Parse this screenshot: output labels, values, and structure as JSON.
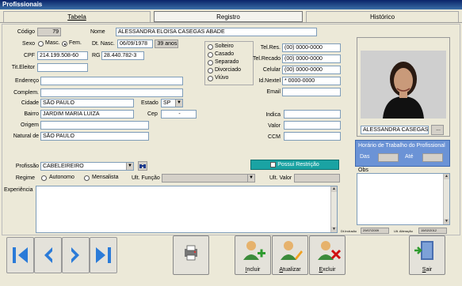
{
  "window": {
    "title": "Profissionais"
  },
  "tabs": [
    {
      "label": "Tabela"
    },
    {
      "label": "Registro"
    },
    {
      "label": "Histórico"
    }
  ],
  "form": {
    "codigo_label": "Código",
    "codigo_value": "79",
    "nome_label": "Nome",
    "nome_value": "ALESSANDRA ELOISA CASEGAS ABADE",
    "sexo_label": "Sexo",
    "sexo_masc": "Masc.",
    "sexo_fem": "Fem.",
    "dt_nasc_label": "Dt. Nasc.",
    "dt_nasc_value": "06/09/1978",
    "idade_value": "39 anos",
    "cpf_label": "CPF",
    "cpf_value": "214.199.508-60",
    "rg_label": "RG",
    "rg_value": "28.440.782-3",
    "tit_eleitor_label": "Tit.Eleitor",
    "tit_eleitor_value": "",
    "endereco_label": "Endereço",
    "endereco_value": "",
    "complem_label": "Complem.",
    "complem_value": "",
    "cidade_label": "Cidade",
    "cidade_value": "SÃO PAULO",
    "estado_label": "Estado",
    "estado_value": "SP",
    "bairro_label": "Bairro",
    "bairro_value": "JARDIM MARIA LUIZA",
    "cep_label": "Cep",
    "cep_value": "-",
    "origem_label": "Origem",
    "origem_value": "",
    "natural_label": "Natural de",
    "natural_value": "SÃO PAULO",
    "estado_civil": [
      "Solteiro",
      "Casado",
      "Separado",
      "Divorciado",
      "Viúvo"
    ],
    "tel_res_label": "Tel.Res.",
    "tel_res_value": "(00) 0000-0000",
    "tel_recado_label": "Tel.Recado",
    "tel_recado_value": "(00) 0000-0000",
    "celular_label": "Celular",
    "celular_value": "(00) 0000-0000",
    "id_nextel_label": "Id.Nextel",
    "id_nextel_value": "* 0000-0000",
    "email_label": "Email",
    "email_value": "",
    "indica_label": "Indica",
    "indica_value": "",
    "valor_label": "Valor",
    "valor_value": "",
    "ccm_label": "CCM",
    "ccm_value": "",
    "profissao_label": "Profissão",
    "profissao_value": "CABELEIREIRO",
    "regime_label": "Regime",
    "regime_autonomo": "Autonomo",
    "regime_mensalista": "Mensalista",
    "ult_funcao_label": "Ult. Função",
    "ult_funcao_value": "",
    "ult_valor_label": "Ult. Valor",
    "ult_valor_value": "",
    "experiencia_label": "Experiência",
    "possui_restricao_label": "Possui Restrição",
    "photo_name": "ALESSANDRA CASEGAS",
    "photo_browse_label": "...",
    "horario_title": "Horário de Trabalho do Profissional",
    "das_label": "Das",
    "das_value": "",
    "ate_label": "Até",
    "ate_value": "",
    "obs_label": "Obs",
    "dt_inclusao_label": "Dt.Inclusão",
    "dt_inclusao_value": "29/07/2009",
    "ult_alteracao_label": "Ult. Alteração",
    "ult_alteracao_value": "15/02/2012"
  },
  "toolbar": {
    "incluir_label": "Incluir",
    "atualizar_label": "Atualizar",
    "excluir_label": "Excluir",
    "sair_label": "Sair"
  },
  "colors": {
    "titlebar": "#0a246a",
    "accent_teal": "#1aa3a3",
    "schedule_blue": "#6b93d6",
    "nav_blue": "#2b7bd8"
  }
}
